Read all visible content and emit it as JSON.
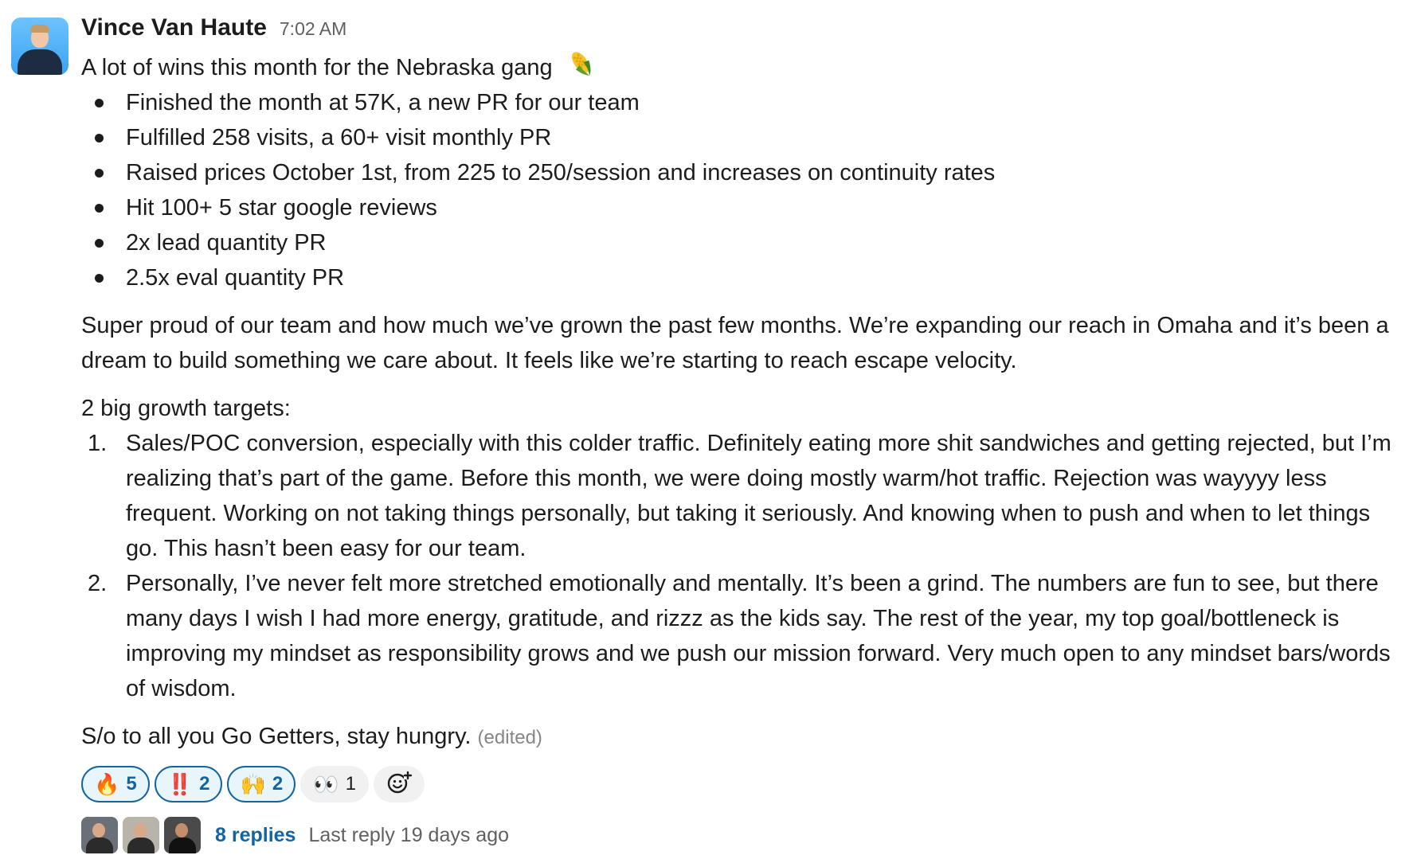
{
  "message": {
    "author": "Vince Van Haute",
    "time": "7:02 AM",
    "intro": "A lot of wins this month for the Nebraska gang",
    "intro_emoji": "corn-icon",
    "wins": [
      "Finished the month at 57K, a new PR for our team",
      "Fulfilled 258 visits, a 60+ visit monthly PR",
      "Raised prices October 1st, from 225 to 250/session and increases on continuity rates",
      "Hit 100+ 5 star google reviews",
      "2x lead quantity PR",
      "2.5x eval quantity PR"
    ],
    "paragraph": "Super proud of our team and how much we’ve grown the past few months. We’re expanding our reach in Omaha and it’s been a dream to build something we care about. It feels like we’re starting to reach escape velocity.",
    "targets_heading": "2 big growth targets:",
    "targets": [
      {
        "num": "1.",
        "text": "Sales/POC conversion, especially with this colder traffic. Definitely eating more shit sandwiches and getting rejected, but I’m realizing that’s part of the game. Before this month, we were doing mostly warm/hot traffic. Rejection was wayyyy less frequent. Working on not taking things personally, but taking it seriously. And knowing when to push and when to let things go. This hasn’t been easy for our team."
      },
      {
        "num": "2.",
        "text": "Personally, I’ve never felt more stretched emotionally and mentally. It’s been a grind. The numbers are fun to see, but there many days I wish I had more energy, gratitude, and rizzz as the kids say. The rest of the year, my top goal/bottleneck is improving my mindset as responsibility grows and we push our mission forward. Very much open to any mindset bars/words of wisdom."
      }
    ],
    "closing": "S/o to all you Go Getters, stay hungry.",
    "edited": "(edited)"
  },
  "reactions": [
    {
      "emoji": "🔥",
      "icon": "fire-icon",
      "count": "5",
      "active": true
    },
    {
      "emoji": "‼️",
      "icon": "double-exclamation-icon",
      "count": "2",
      "active": true
    },
    {
      "emoji": "🙌",
      "icon": "raised-hands-icon",
      "count": "2",
      "active": true
    },
    {
      "emoji": "👀",
      "icon": "eyes-icon",
      "count": "1",
      "active": false
    }
  ],
  "add_reaction_icon": "add-reaction-icon",
  "thread": {
    "replies": "8 replies",
    "last_reply": "Last reply 19 days ago"
  },
  "colors": {
    "link_blue": "#1264a3",
    "reaction_active_bg": "#e8f5fa",
    "muted_text": "#616061"
  }
}
